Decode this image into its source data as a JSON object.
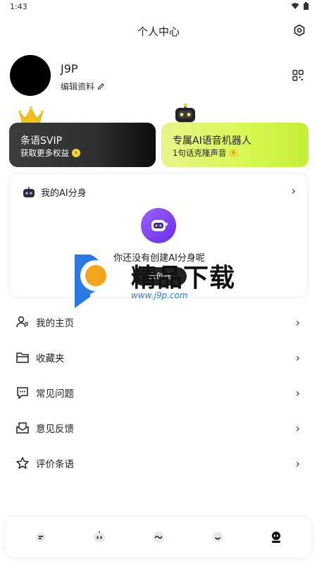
{
  "status_bar": {
    "time": "1:43"
  },
  "header": {
    "title": "个人中心"
  },
  "profile": {
    "username": "J9P",
    "edit_label": "编辑资料"
  },
  "cards": {
    "vip": {
      "title": "条语SVIP",
      "subtitle": "获取更多权益"
    },
    "robot": {
      "title": "专属AI语音机器人",
      "subtitle": "1句话克隆声音"
    }
  },
  "ai_section": {
    "title": "我的AI分身",
    "empty_text": "你还没有创建AI分身呢",
    "create_label": "去创建"
  },
  "watermark": {
    "text": "精品下载",
    "url": "www.j9p.com"
  },
  "menu": {
    "items": [
      {
        "label": "我的主页",
        "icon": "user-home-icon"
      },
      {
        "label": "收藏夹",
        "icon": "folder-icon"
      },
      {
        "label": "常见问题",
        "icon": "faq-chat-icon"
      },
      {
        "label": "意见反馈",
        "icon": "feedback-mail-icon"
      },
      {
        "label": "评价条语",
        "icon": "star-icon"
      }
    ]
  },
  "tabbar": {
    "tabs": [
      {
        "icon": "chat-bubble-icon"
      },
      {
        "icon": "robot-icon"
      },
      {
        "icon": "wave-icon"
      },
      {
        "icon": "character-icon"
      },
      {
        "icon": "profile-icon",
        "active": true
      }
    ]
  },
  "colors": {
    "accent_yellow": "#f2d531",
    "lime": "#d6f84f",
    "purple": "#7b3cf0"
  }
}
